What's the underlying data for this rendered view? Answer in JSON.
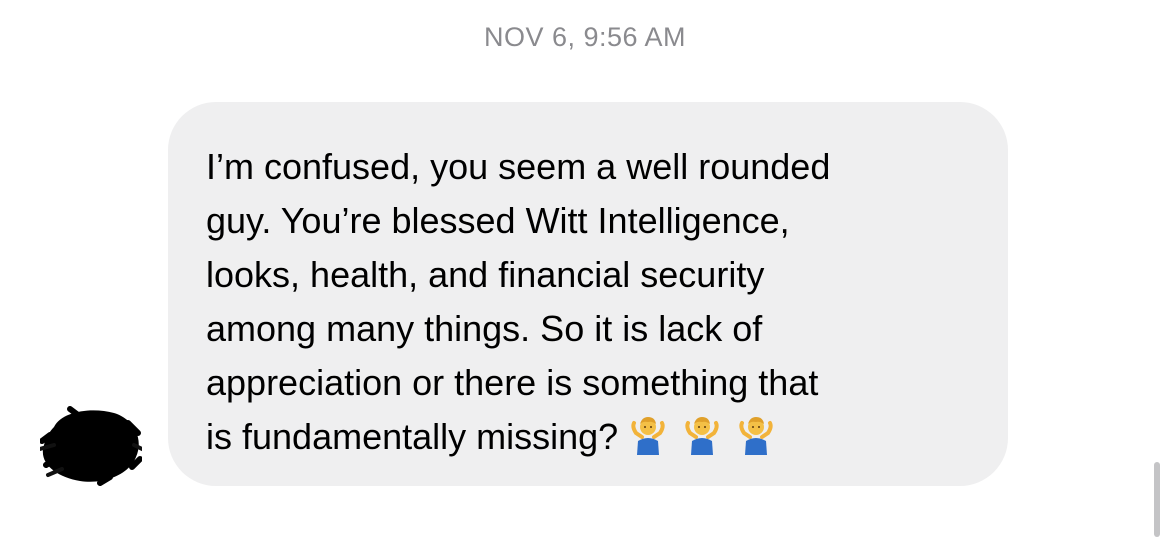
{
  "conversation": {
    "timestamp": "NOV 6, 9:56 AM"
  },
  "message": {
    "lines": [
      "I’m confused, you seem a well rounded",
      "guy. You’re blessed Witt Intelligence,",
      "looks, health, and financial security",
      "among many things. So it is lack of",
      "appreciation or there is something that",
      "is fundamentally missing?"
    ],
    "emoji_icons": [
      "man-shrugging-icon",
      "man-shrugging-icon",
      "man-shrugging-icon"
    ]
  },
  "colors": {
    "bubble_background": "#efeff0",
    "timestamp_text": "#8a8a8e",
    "message_text": "#000000"
  }
}
